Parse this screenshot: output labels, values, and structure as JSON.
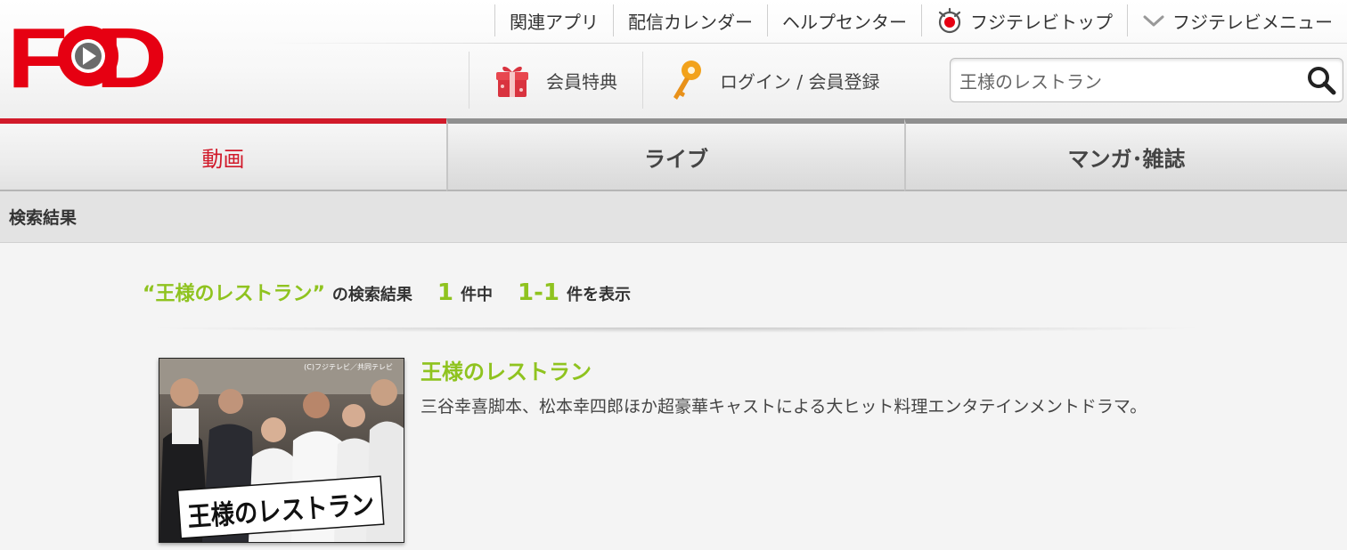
{
  "header": {
    "logo_text": "FOD",
    "top_links": [
      {
        "label": "関連アプリ",
        "icon": ""
      },
      {
        "label": "配信カレンダー",
        "icon": ""
      },
      {
        "label": "ヘルプセンター",
        "icon": ""
      },
      {
        "label": "フジテレビトップ",
        "icon": "fujitv-eye-icon"
      },
      {
        "label": "フジテレビメニュー",
        "icon": "chevron-down-icon"
      }
    ],
    "member_links": [
      {
        "label": "会員特典",
        "icon": "gift-icon"
      },
      {
        "label": "ログイン / 会員登録",
        "icon": "key-icon"
      }
    ],
    "search": {
      "value": "王様のレストラン",
      "icon": "search-icon"
    }
  },
  "tabs": [
    {
      "label": "動画",
      "active": true
    },
    {
      "label": "ライブ",
      "active": false
    },
    {
      "label": "マンガ･雑誌",
      "active": false
    }
  ],
  "section": {
    "title": "検索結果"
  },
  "summary": {
    "keyword": "“王様のレストラン”",
    "suffix": "の検索結果",
    "total": "1",
    "total_unit": "件中",
    "range": "1-1",
    "range_unit": "件を表示"
  },
  "results": [
    {
      "title": "王様のレストラン",
      "description": "三谷幸喜脚本、松本幸四郎ほか超豪華キャストによる大ヒット料理エンタテインメントドラマ。",
      "thumbnail": {
        "title_art": "王様のレストラン",
        "credit": "(C)フジテレビ／共同テレビ"
      }
    }
  ],
  "colors": {
    "brand_red": "#e60012",
    "tab_active": "#d11a2a",
    "accent_green": "#8fc31f"
  }
}
